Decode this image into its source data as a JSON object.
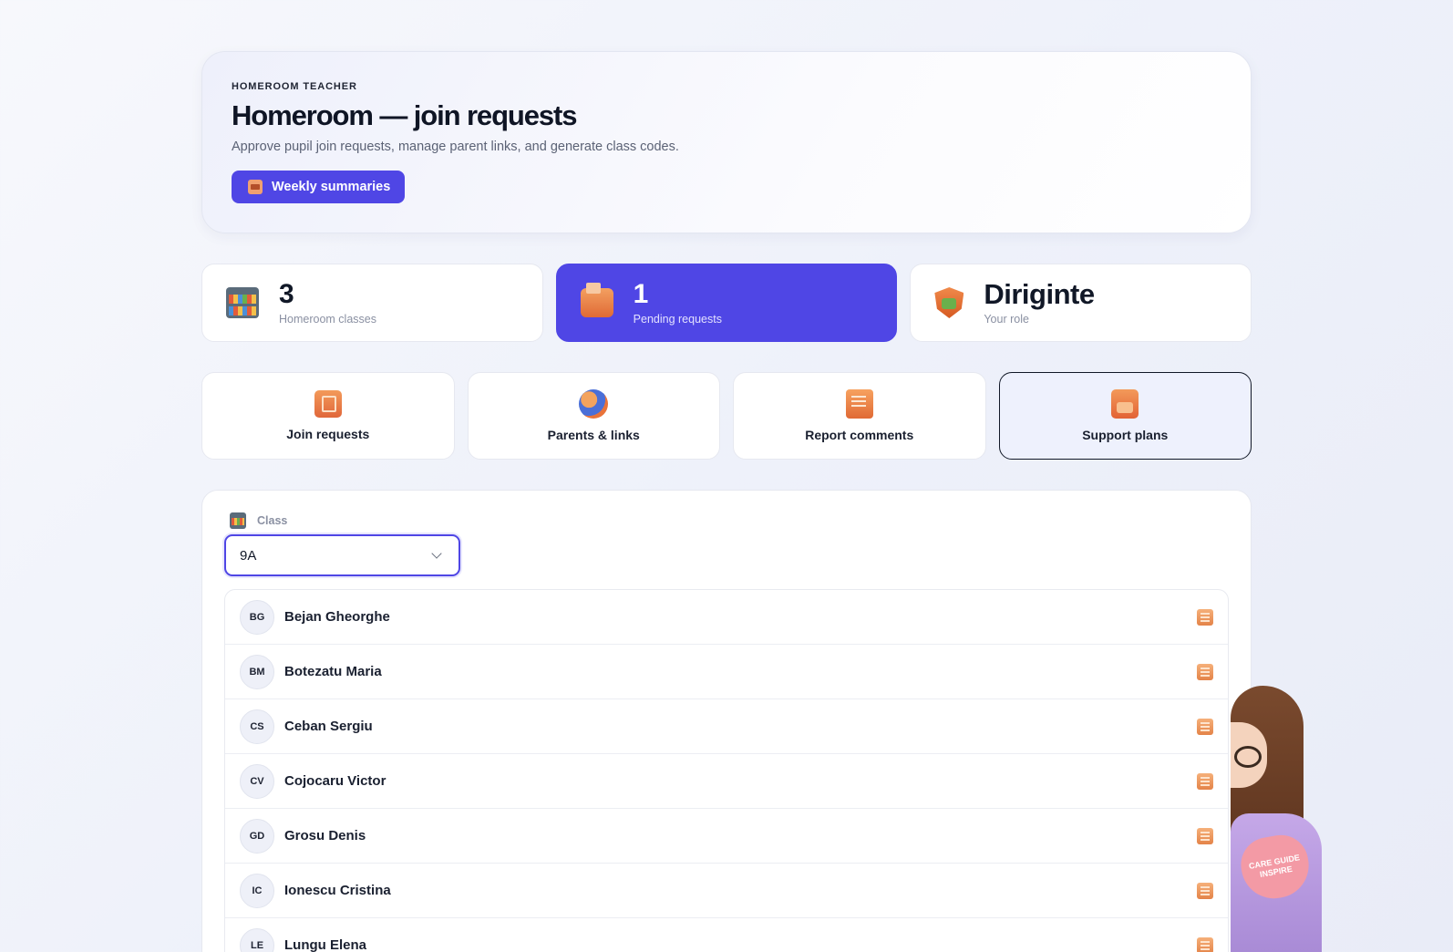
{
  "header": {
    "eyebrow": "HOMEROOM TEACHER",
    "title": "Homeroom — join requests",
    "subtitle": "Approve pupil join requests, manage parent links, and generate class codes.",
    "weekly_button": "Weekly summaries"
  },
  "stats": [
    {
      "value": "3",
      "label": "Homeroom classes",
      "icon": "bookshelf-icon"
    },
    {
      "value": "1",
      "label": "Pending requests",
      "icon": "toolbox-icon"
    },
    {
      "value": "Diriginte",
      "label": "Your role",
      "icon": "shield-icon"
    }
  ],
  "tabs": [
    {
      "label": "Join requests",
      "icon": "door-icon"
    },
    {
      "label": "Parents & links",
      "icon": "people-icon"
    },
    {
      "label": "Report comments",
      "icon": "report-icon"
    },
    {
      "label": "Support plans",
      "icon": "support-plan-icon"
    }
  ],
  "class_field": {
    "label": "Class",
    "value": "9A"
  },
  "pupils": [
    {
      "initials": "BG",
      "name": "Bejan Gheorghe"
    },
    {
      "initials": "BM",
      "name": "Botezatu Maria"
    },
    {
      "initials": "CS",
      "name": "Ceban Sergiu"
    },
    {
      "initials": "CV",
      "name": "Cojocaru Victor"
    },
    {
      "initials": "GD",
      "name": "Grosu Denis"
    },
    {
      "initials": "IC",
      "name": "Ionescu Cristina"
    },
    {
      "initials": "LE",
      "name": "Lungu Elena"
    }
  ],
  "mascot": {
    "badge_text": "CARE GUIDE INSPIRE"
  },
  "colors": {
    "accent": "#4f46e5",
    "active_tab_bg": "#eef1fd"
  }
}
